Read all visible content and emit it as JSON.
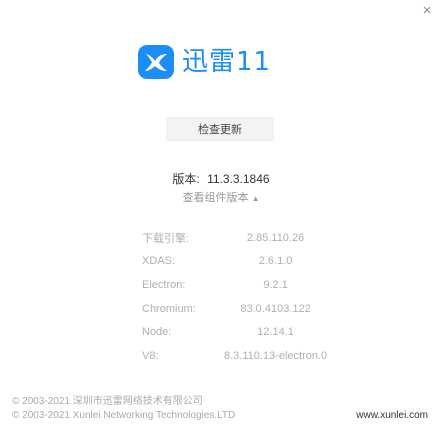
{
  "window": {
    "close_glyph": "×"
  },
  "logo": {
    "text": "迅雷11",
    "icon": "xunlei-bird-icon",
    "color": "#1b8ef5"
  },
  "check_update": {
    "label": "检查更新"
  },
  "version": {
    "label": "版本:",
    "value": "11.3.3.1846"
  },
  "components_toggle": {
    "label": "查看组件版本",
    "arrow": "▲"
  },
  "components": [
    {
      "name": "下载引擎:",
      "version": "2.85.110.26"
    },
    {
      "name": "XDAS:",
      "version": "2.6.1.0"
    },
    {
      "name": "Electron:",
      "version": "9.2.1"
    },
    {
      "name": "Chromium:",
      "version": "83.0.4103.122"
    },
    {
      "name": "Node:",
      "version": "12.14.1"
    },
    {
      "name": "V8:",
      "version": "8.3.110.13-electron.0"
    }
  ],
  "footer": {
    "copyright_cn": "© 2003-2021 深圳市迅雷网络技术有限公司",
    "copyright_en": "© 2003-2021 Xunlei Networking Technologies.LTD",
    "website": "www.xunlei.com"
  }
}
